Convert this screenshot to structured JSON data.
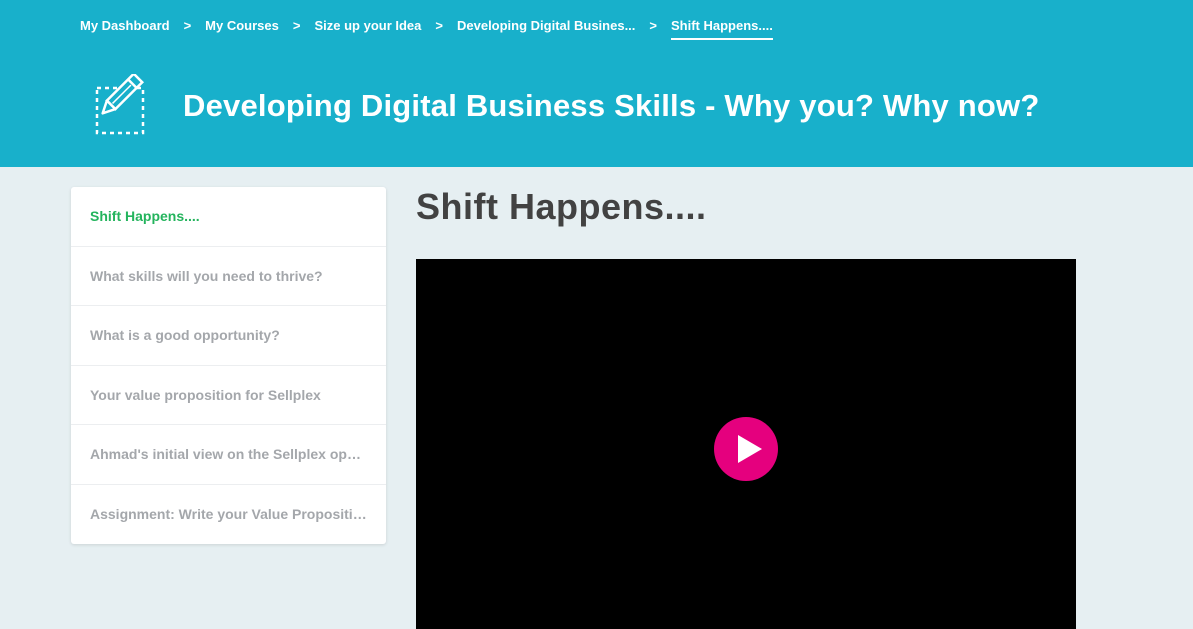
{
  "breadcrumb": {
    "items": [
      "My Dashboard",
      "My Courses",
      "Size up your Idea",
      "Developing Digital Busines...",
      "Shift Happens...."
    ],
    "separator": ">"
  },
  "header": {
    "icon": "pencil-edit-icon",
    "title": "Developing Digital Business Skills - Why you? Why now?"
  },
  "sidebar": {
    "lessons": [
      "Shift Happens....",
      "What skills will you need to thrive?",
      "What is a good opportunity?",
      "Your value proposition for Sellplex",
      "Ahmad's initial view on the Sellplex opportunity",
      "Assignment: Write your Value Proposition"
    ],
    "active_index": 0
  },
  "main": {
    "title": "Shift Happens....",
    "video": {
      "play_icon": "play-icon"
    }
  },
  "colors": {
    "header_bg": "#18b0cb",
    "page_bg": "#e6eff2",
    "active_lesson": "#24b45d",
    "inactive_lesson": "#a4a7ab",
    "play_button": "#e5007e"
  }
}
